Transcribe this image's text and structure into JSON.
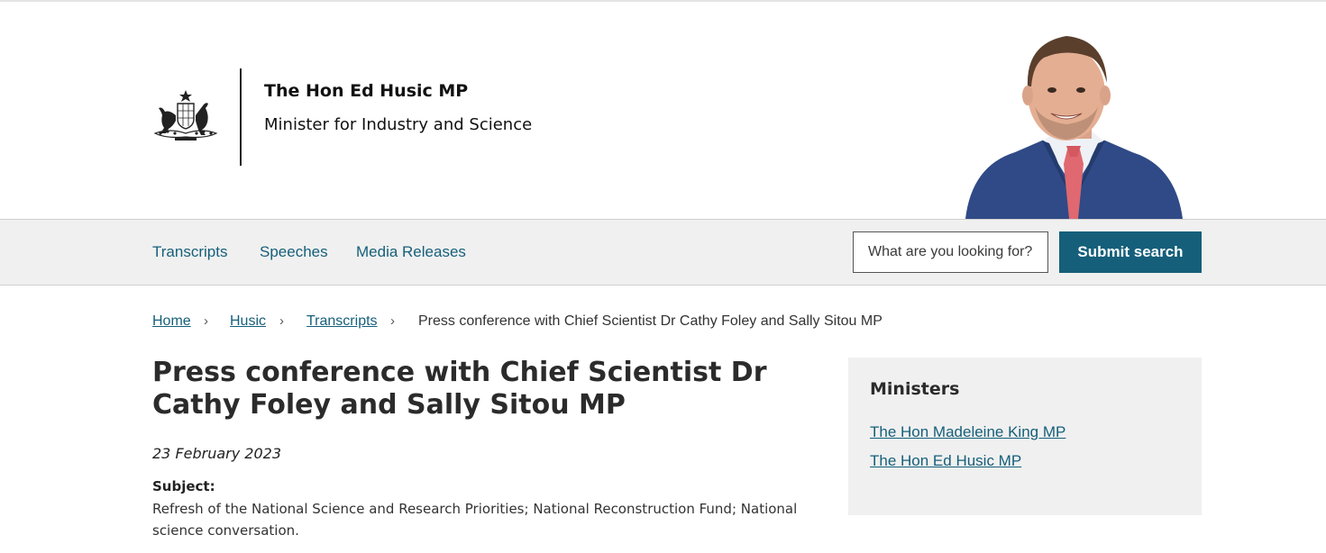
{
  "header": {
    "minister_name": "The Hon Ed Husic MP",
    "minister_role": "Minister for Industry and Science",
    "crest_icon": "coat-of-arms-icon",
    "portrait": "minister-portrait"
  },
  "nav": {
    "items": [
      {
        "label": "Transcripts"
      },
      {
        "label": "Speeches"
      },
      {
        "label": "Media Releases"
      }
    ],
    "search": {
      "placeholder": "What are you looking for?",
      "button_label": "Submit search"
    }
  },
  "breadcrumb": {
    "items": [
      {
        "label": "Home"
      },
      {
        "label": "Husic"
      },
      {
        "label": "Transcripts"
      }
    ],
    "separator": "›",
    "current": "Press conference with Chief Scientist Dr Cathy Foley and Sally Sitou MP"
  },
  "article": {
    "title": "Press conference with Chief Scientist Dr Cathy Foley and Sally Sitou MP",
    "date": "23 February 2023",
    "subject_label": "Subject:",
    "subject_text": "Refresh of the National Science and Research Priorities; National Reconstruction Fund; National science conversation."
  },
  "sidebar": {
    "title": "Ministers",
    "links": [
      {
        "label": "The Hon Madeleine King MP"
      },
      {
        "label": "The Hon Ed Husic MP"
      }
    ]
  },
  "colors": {
    "accent": "#155f7a",
    "nav_background": "#f0f0f0",
    "text": "#222222"
  }
}
